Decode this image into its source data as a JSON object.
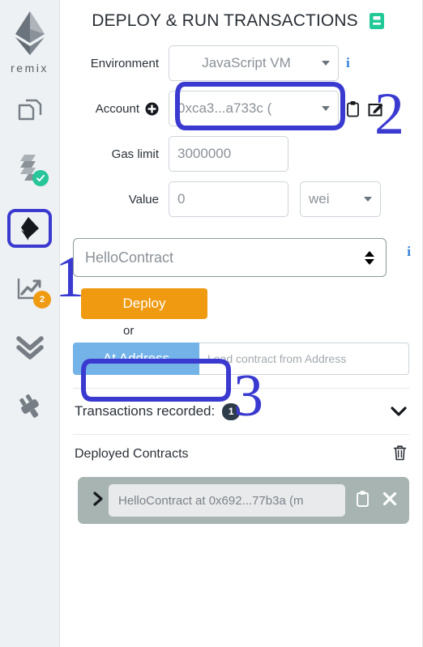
{
  "app": {
    "brand": "remix",
    "accent_orange": "#ef9a11",
    "accent_blue": "#74b3e8",
    "annotation_color": "#3a3ad0",
    "panel_bg": "#ffffff",
    "sidebar_bg": "#eef1f3"
  },
  "sidebar": {
    "logo_name": "ethereum-diamond-logo",
    "items": [
      {
        "id": "file-explorers",
        "icon": "copy-files-icon",
        "badge": null
      },
      {
        "id": "solidity-compiler",
        "icon": "solidity-icon",
        "badge": "check",
        "badge_color": "#28c49a"
      },
      {
        "id": "deploy-run-transactions",
        "icon": "deploy-diamond-icon",
        "badge": null,
        "selected": true
      },
      {
        "id": "debugger-analytics",
        "icon": "chart-line-icon",
        "badge": "2",
        "badge_color": "#ef9a11"
      },
      {
        "id": "static-analysis",
        "icon": "double-chevron-down-icon",
        "badge": null
      },
      {
        "id": "plugin-manager",
        "icon": "plug-icon",
        "badge": null
      }
    ]
  },
  "header": {
    "title": "DEPLOY & RUN TRANSACTIONS",
    "doc_icon": "green-book-icon"
  },
  "form": {
    "environment": {
      "label": "Environment",
      "value": "JavaScript VM",
      "info_icon": "info-icon"
    },
    "account": {
      "label": "Account",
      "add_icon": "plus-circle-icon",
      "value": "0xca3...a733c (",
      "copy_icon": "clipboard-icon",
      "edit_icon": "edit-square-icon"
    },
    "gas_limit": {
      "label": "Gas limit",
      "value": "3000000"
    },
    "value": {
      "label": "Value",
      "value": "0",
      "unit": "wei"
    }
  },
  "contract": {
    "selected": "HelloContract",
    "info_icon": "info-icon",
    "deploy_label": "Deploy",
    "or_label": "or",
    "at_address_label": "At Address",
    "at_address_placeholder": "Load contract from Address"
  },
  "transactions": {
    "label": "Transactions recorded:",
    "count": "1",
    "chevron_icon": "chevron-down-icon"
  },
  "deployed": {
    "title": "Deployed Contracts",
    "clear_icon": "trash-icon",
    "items": [
      {
        "expand_icon": "chevron-right-icon",
        "label": "HelloContract at 0x692...77b3a (m",
        "copy_icon": "clipboard-icon",
        "close_icon": "close-x-icon"
      }
    ]
  },
  "annotations": {
    "one": "1",
    "two": "2",
    "three": "3"
  }
}
